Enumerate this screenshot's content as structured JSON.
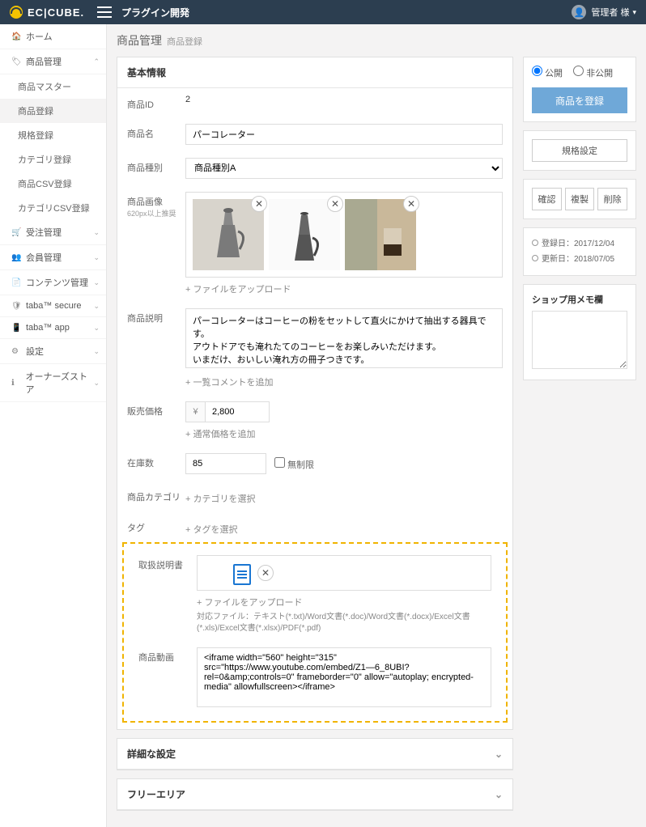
{
  "header": {
    "logo": "EC|CUBE.",
    "title": "プラグイン開発",
    "user": "管理者 様"
  },
  "sidebar": {
    "items": [
      {
        "icon": "🏠",
        "label": "ホーム"
      },
      {
        "icon": "🏷",
        "label": "商品管理",
        "expanded": true
      },
      {
        "sub": true,
        "label": "商品マスター"
      },
      {
        "sub": true,
        "label": "商品登録",
        "active": true
      },
      {
        "sub": true,
        "label": "規格登録"
      },
      {
        "sub": true,
        "label": "カテゴリ登録"
      },
      {
        "sub": true,
        "label": "商品CSV登録"
      },
      {
        "sub": true,
        "label": "カテゴリCSV登録"
      },
      {
        "icon": "🛒",
        "label": "受注管理",
        "caret": true
      },
      {
        "icon": "👥",
        "label": "会員管理",
        "caret": true
      },
      {
        "icon": "📄",
        "label": "コンテンツ管理",
        "caret": true
      },
      {
        "icon": "🛡",
        "label": "taba™ secure",
        "caret": true
      },
      {
        "icon": "📱",
        "label": "taba™ app",
        "caret": true
      },
      {
        "icon": "⚙",
        "label": "設定",
        "caret": true
      },
      {
        "icon": "ℹ",
        "label": "オーナーズストア",
        "caret": true
      }
    ]
  },
  "page": {
    "title": "商品管理",
    "sub": "商品登録"
  },
  "basic": {
    "heading": "基本情報",
    "id_label": "商品ID",
    "id": "2",
    "name_label": "商品名",
    "name": "パーコレーター",
    "type_label": "商品種別",
    "type": "商品種別A",
    "image_label": "商品画像",
    "image_hint": "620px以上推奨",
    "upload_label": "ファイルをアップロード",
    "desc_label": "商品説明",
    "desc": "パーコレーターはコーヒーの粉をセットして直火にかけて抽出する器具です。\nアウトドアでも淹れたてのコーヒーをお楽しみいただけます。\nいまだけ、おいしい淹れ方の冊子つきです。",
    "add_comment": "一覧コメントを追加",
    "price_label": "販売価格",
    "price_cur": "¥",
    "price": "2,800",
    "add_price": "通常価格を追加",
    "stock_label": "在庫数",
    "stock": "85",
    "unlimited": "無制限",
    "category_label": "商品カテゴリ",
    "add_category": "カテゴリを選択",
    "tag_label": "タグ",
    "add_tag": "タグを選択",
    "manual_label": "取扱説明書",
    "manual_hint": "対応ファイル：テキスト(*.txt)/Word文書(*.doc)/Word文書(*.docx)/Excel文書(*.xls)/Excel文書(*.xlsx)/PDF(*.pdf)",
    "video_label": "商品動画",
    "video": "<iframe width=\"560\" height=\"315\" src=\"https://www.youtube.com/embed/Z1―6_8UBI?rel=0&amp;controls=0\" frameborder=\"0\" allow=\"autoplay; encrypted-media\" allowfullscreen></iframe>"
  },
  "panels": {
    "detail": "詳細な設定",
    "free": "フリーエリア"
  },
  "side": {
    "publish": "公開",
    "unpublish": "非公開",
    "register": "商品を登録",
    "spec": "規格設定",
    "confirm": "確認",
    "copy": "複製",
    "delete": "削除",
    "created_lbl": "登録日：",
    "created": "2017/12/04",
    "updated_lbl": "更新日：",
    "updated": "2018/07/05",
    "memo_lbl": "ショップ用メモ欄"
  }
}
